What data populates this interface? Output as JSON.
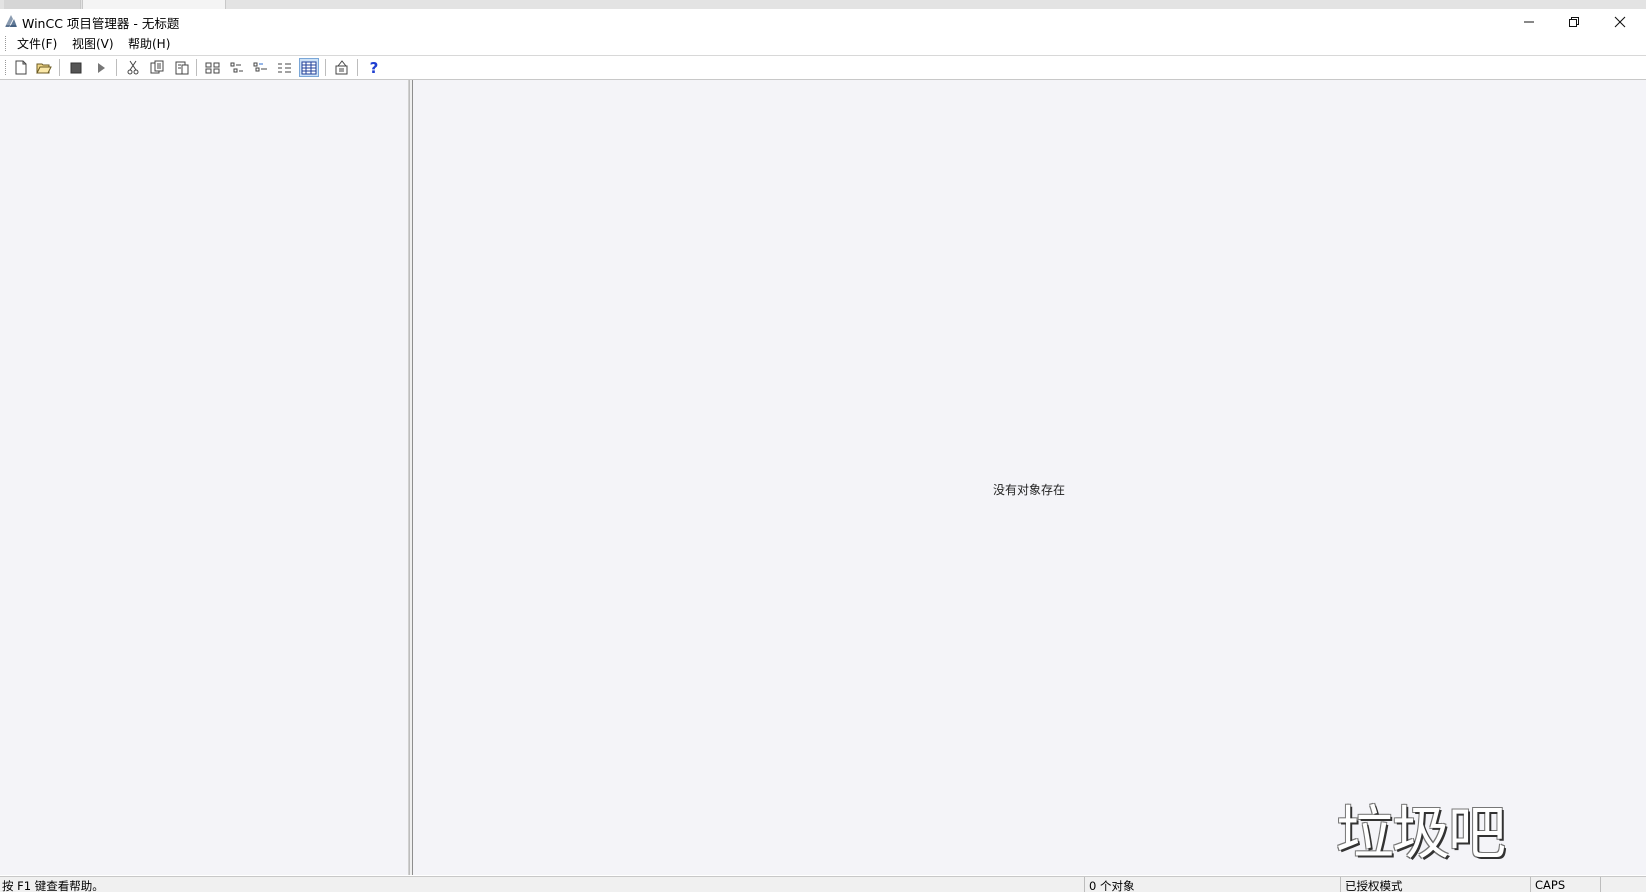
{
  "window": {
    "title": "WinCC 项目管理器 - 无标题",
    "controls": {
      "minimize": "—",
      "maximize": "❐",
      "close": "✕"
    }
  },
  "menu": {
    "items": [
      {
        "label": "文件(F)"
      },
      {
        "label": "视图(V)"
      },
      {
        "label": "帮助(H)"
      }
    ]
  },
  "toolbar": {
    "help_glyph": "?"
  },
  "content": {
    "empty_message": "没有对象存在"
  },
  "watermark": {
    "text": "垃圾吧"
  },
  "statusbar": {
    "help_text": "按 F1 键查看帮助。",
    "object_count": "0 个对象",
    "mode": "已授权模式",
    "caps": "CAPS"
  },
  "colors": {
    "pane_background": "#f4f4f8",
    "help_icon": "#1f3fd1",
    "active_button": "#cfe3f7"
  }
}
